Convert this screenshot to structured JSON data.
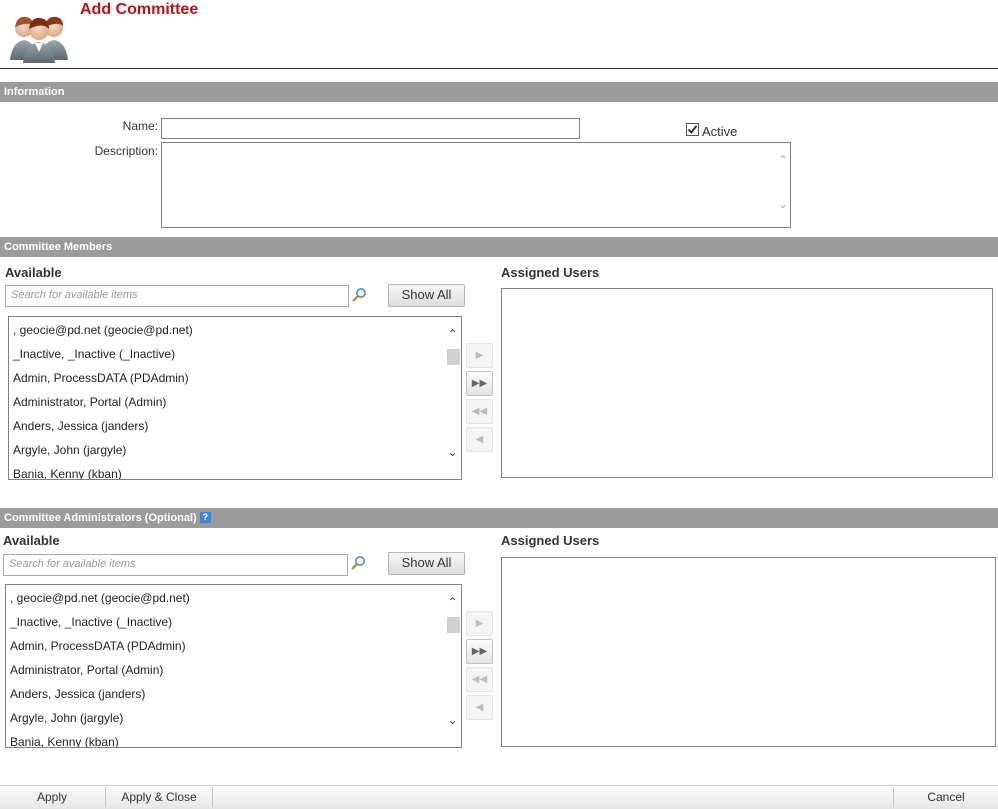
{
  "header": {
    "title": "Add Committee",
    "logo_icon": "users-group-icon"
  },
  "information": {
    "section_title": "Information",
    "name_label": "Name:",
    "name_value": "",
    "description_label": "Description:",
    "description_value": "",
    "active_label": "Active",
    "active_checked": true
  },
  "members": {
    "section_title": "Committee Members",
    "available_heading": "Available",
    "search_placeholder": "Search for available items",
    "show_all_label": "Show All",
    "assigned_heading": "Assigned Users",
    "items": [
      ", geocie@pd.net (geocie@pd.net)",
      "_Inactive, _Inactive (_Inactive)",
      "Admin, ProcessDATA (PDAdmin)",
      "Administrator, Portal (Admin)",
      "Anders, Jessica (janders)",
      "Argyle, John (jargyle)",
      "Bania, Kenny (kban)"
    ],
    "assigned_items": []
  },
  "administrators": {
    "section_title": "Committee Administrators (Optional)",
    "help_icon": "help-icon",
    "help_glyph": "?",
    "available_heading": "Available",
    "search_placeholder": "Search for available items",
    "show_all_label": "Show All",
    "assigned_heading": "Assigned Users",
    "items": [
      ", geocie@pd.net (geocie@pd.net)",
      "_Inactive, _Inactive (_Inactive)",
      "Admin, ProcessDATA (PDAdmin)",
      "Administrator, Portal (Admin)",
      "Anders, Jessica (janders)",
      "Argyle, John (jargyle)",
      "Bania, Kenny (kban)"
    ],
    "assigned_items": []
  },
  "transfer_buttons": {
    "move_selected": "▶",
    "move_all": "▶▶",
    "remove_all": "◀◀",
    "remove_selected": "◀"
  },
  "scroll": {
    "up": "⌃",
    "down": "⌄"
  },
  "footer": {
    "apply_label": "Apply",
    "apply_close_label": "Apply & Close",
    "cancel_label": "Cancel"
  },
  "colors": {
    "title": "#b7141a",
    "section_bar": "#9b9b9b",
    "help_icon": "#3f86d8"
  }
}
